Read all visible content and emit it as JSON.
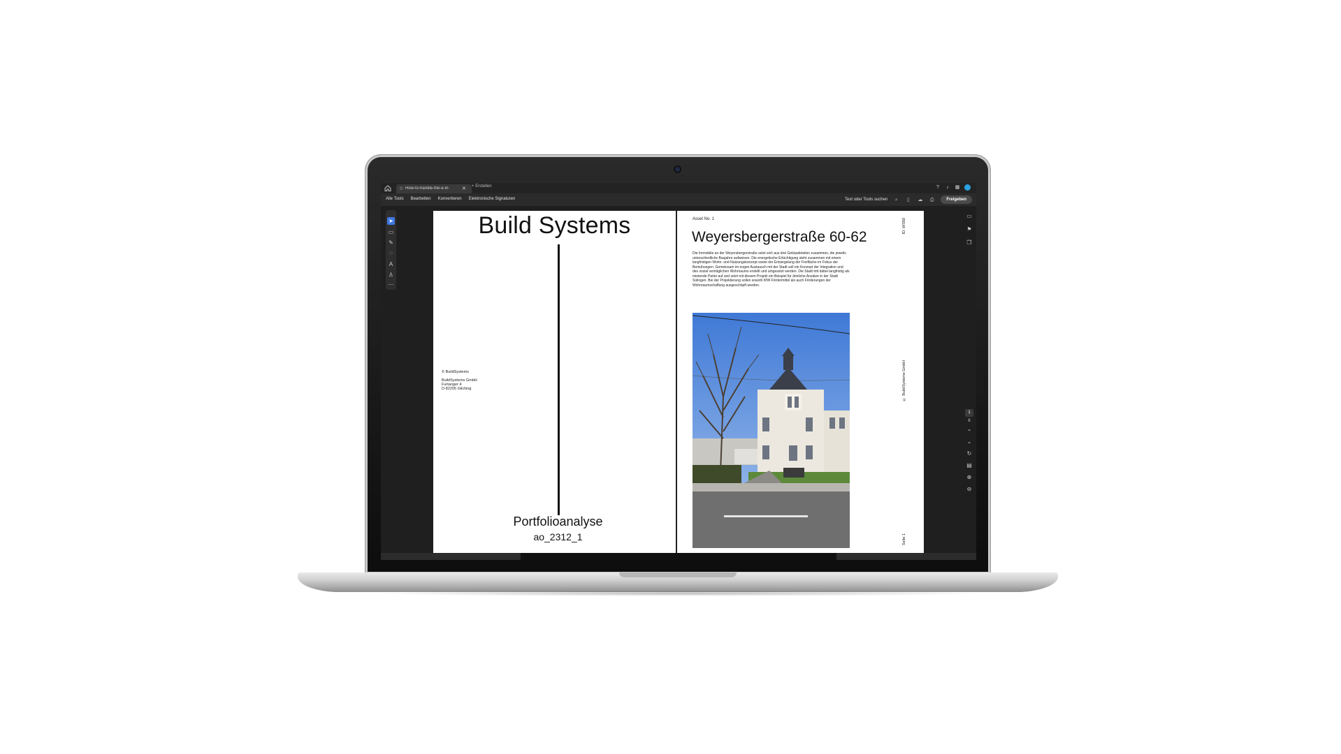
{
  "browser": {
    "tab_title": "How-to-handle-the-e-in-",
    "new_tab_label": "Erstellen"
  },
  "menubar": {
    "items": [
      "Alle Tools",
      "Bearbeiten",
      "Konvertieren",
      "Elektronische Signaturen"
    ],
    "search_label": "Text oder Tools suchen",
    "share_label": "Freigeben"
  },
  "navigation": {
    "current_page": "1",
    "page_count": "6"
  },
  "left_page": {
    "title": "Build Systems",
    "copyright": "© BuildSystems",
    "address": [
      "BuildSystems GmbH",
      "Furtanger 4",
      "D-82205 Gilching"
    ],
    "subtitle": "Portfolioanalyse",
    "code": "ao_2312_1"
  },
  "right_page": {
    "asset_label": "Asset No. 1",
    "title": "Weyersbergerstraße 60-62",
    "body": "Die Immobilie an der Weyersbergerstraße setzt sich aus drei Gebäudeteilen zusammen, die jeweils unterschiedliche Baujahre aufweisen. Die energetische Ertüchtigung steht zusammen mit einem langfristigen Wohn- und Nutzungskonzept sowie der Entsiegelung der Freifläche im Fokus der Bemühungen. Gemeinsam im engen Austausch mit der Stadt soll ein Konzept der Integration und des sozial verträglichen Wohnraums erstellt und umgesetzt werden. Die Stadt tritt dabei langfristig als mietende Partei auf und setzt mit diesem Projekt ein Beispiel für ähnliche Ansätze in der Stadt Solingen. Bei der Projektierung sollen sowohl KfW Fördermittel als auch Förderungen der Wohnraumschaffung ausgeschöpft werden.",
    "side_id": "ID: WS60",
    "side_copyright": "© BuildSystems GmbH",
    "page_label": "Seite 1"
  },
  "colors": {
    "accent": "#3e78e0",
    "avatar": "#2aa3e0",
    "app_background": "#1f1f1f"
  }
}
